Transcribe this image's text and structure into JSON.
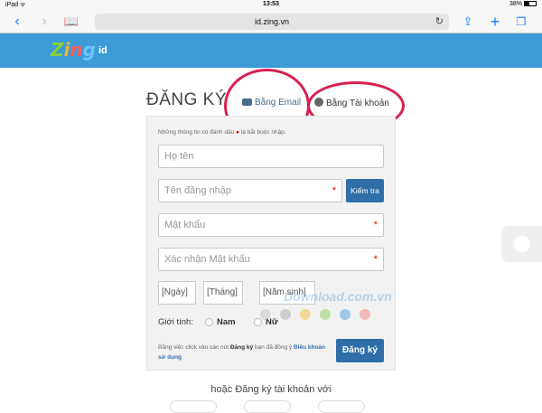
{
  "status_bar": {
    "left": "iPad",
    "time": "13:53",
    "battery": "38%"
  },
  "browser": {
    "url": "id.zing.vn"
  },
  "header": {
    "logo": "Zing",
    "logo_suffix": "id"
  },
  "page": {
    "title": "ĐĂNG KÝ",
    "tab_email": "Bằng Email",
    "tab_account": "Bằng Tài khoản"
  },
  "form": {
    "note": "Những thông tin có đánh dấu",
    "note_tail": "là bắt buộc nhập.",
    "fullname_placeholder": "Họ tên",
    "username_placeholder": "Tên đăng nhập",
    "check_button": "Kiểm tra",
    "password_placeholder": "Mật khẩu",
    "confirm_placeholder": "Xác nhận Mật khẩu",
    "day": "[Ngày]",
    "month": "[Tháng]",
    "year": "[Năm sinh]",
    "gender_label": "Giới tính:",
    "male": "Nam",
    "female": "Nữ",
    "terms_pre": "Bằng việc click vào các nút",
    "terms_bold": "Đăng ký",
    "terms_mid": "bạn đã đồng ý",
    "terms_link": "Điều khoản sử dụng",
    "submit": "Đăng ký"
  },
  "footer": {
    "or_text": "hoặc Đăng ký tài khoản với"
  },
  "watermark": {
    "text": "Download.com.vn"
  },
  "colors": {
    "header": "#3d9cd7",
    "button": "#2f6ea8",
    "highlight": "#d8204f"
  }
}
